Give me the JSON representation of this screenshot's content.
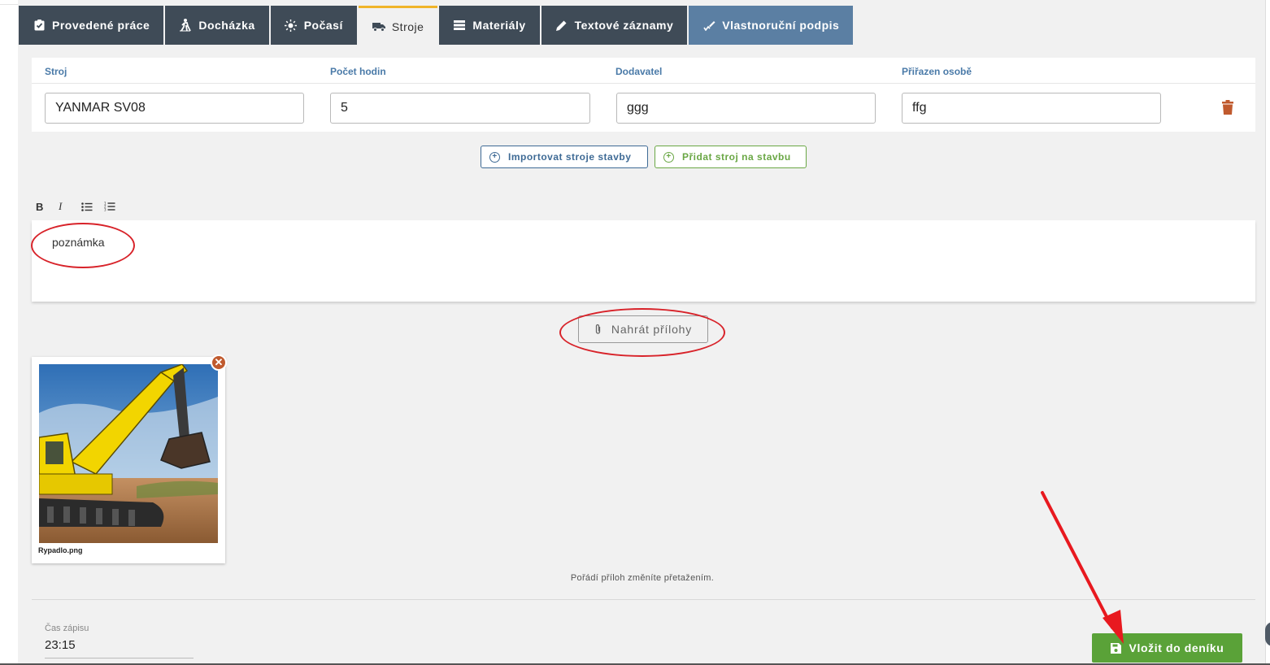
{
  "tabs": [
    {
      "label": "Provedené práce",
      "icon": "clipboard-check-icon"
    },
    {
      "label": "Docházka",
      "icon": "person-walking-icon"
    },
    {
      "label": "Počasí",
      "icon": "sun-icon"
    },
    {
      "label": "Stroje",
      "icon": "truck-icon"
    },
    {
      "label": "Materiály",
      "icon": "layers-icon"
    },
    {
      "label": "Textové záznamy",
      "icon": "pencil-icon"
    },
    {
      "label": "Vlastnoruční podpis",
      "icon": "signature-icon"
    }
  ],
  "machines": {
    "headers": {
      "machine": "Stroj",
      "hours": "Počet hodin",
      "supplier": "Dodavatel",
      "assigned": "Přiřazen osobě"
    },
    "rows": [
      {
        "machine": "YANMAR SV08",
        "hours": "5",
        "supplier": "ggg",
        "assigned": "ffg"
      }
    ]
  },
  "actions": {
    "import_label": "Importovat stroje stavby",
    "add_label": "Přidat stroj na stavbu"
  },
  "editor": {
    "toolbar": [
      "B",
      "I",
      "bulleted-list-icon",
      "numbered-list-icon"
    ],
    "note_text": "poznámka"
  },
  "attachments": {
    "upload_label": "Nahrát přílohy",
    "items": [
      {
        "file_name": "Rypadlo.png"
      }
    ],
    "reorder_hint": "Pořádí příloh změníte přetažením."
  },
  "entry": {
    "time_label": "Čas zápisu",
    "time_value": "23:15",
    "save_label": "Vložit do deníku"
  },
  "colors": {
    "tab_bg": "#3f4b57",
    "tab_signature_bg": "#5b7fa3",
    "active_tab_accent": "#f0b429",
    "header_blue": "#4a7aa8",
    "green": "#5aa238",
    "delete_orange": "#c05a2e",
    "annotation_red": "#d8232a"
  }
}
